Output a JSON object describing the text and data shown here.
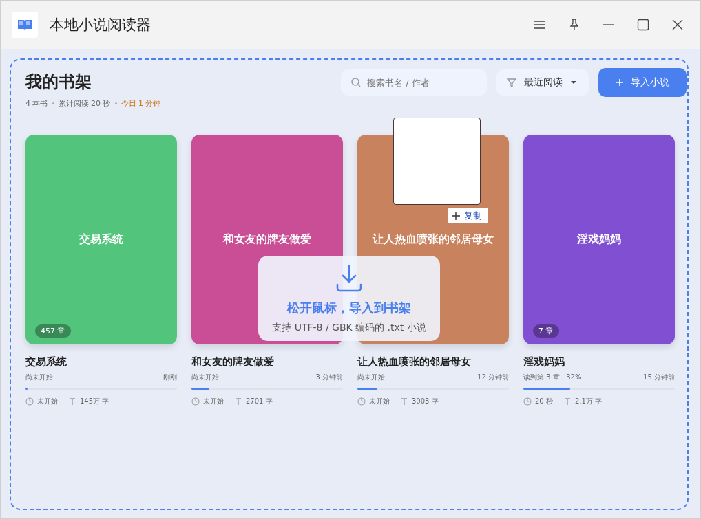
{
  "window": {
    "title": "本地小说阅读器"
  },
  "shelf": {
    "title": "我的书架",
    "stats": [
      "4 本书",
      "累计阅读 20 秒"
    ],
    "today": "今日 1 分钟",
    "search": {
      "placeholder": "搜索书名 / 作者"
    },
    "sort": "最近阅读",
    "import_button": "导入小说"
  },
  "books": [
    {
      "title": "交易系统",
      "cover_title": "交易系统",
      "chapters": "457 章",
      "status": "尚未开始",
      "time": "刚刚",
      "level": 0.01,
      "read": "未开始",
      "words": "145万 字",
      "color": "#52c47c"
    },
    {
      "title": "和女友的牌友做爱",
      "cover_title": "和女友的牌友做爱",
      "status": "尚未开始",
      "time": "3 分钟前",
      "level": 0.12,
      "read": "未开始",
      "words": "2701 字",
      "color": "#c94e96"
    },
    {
      "title": "让人热血喷张的邻居母女",
      "cover_title": "让人热血喷张的邻居母女",
      "status": "尚未开始",
      "time": "12 分钟前",
      "level": 0.13,
      "read": "未开始",
      "words": "3003 字",
      "color": "#c9825e"
    },
    {
      "title": "淫戏妈妈",
      "cover_title": "淫戏妈妈",
      "chapters": "7 章",
      "status": "读到第 3 章 · 32%",
      "time": "15 分钟前",
      "level": 0.31,
      "read": "20 秒",
      "words": "2.1万 字",
      "color": "#8150d2"
    }
  ],
  "drop_overlay": {
    "title": "松开鼠标，导入到书架",
    "hint": "支持 UTF-8 / GBK 编码的 .txt 小说"
  },
  "drag_cursor": {
    "label": "复制"
  }
}
